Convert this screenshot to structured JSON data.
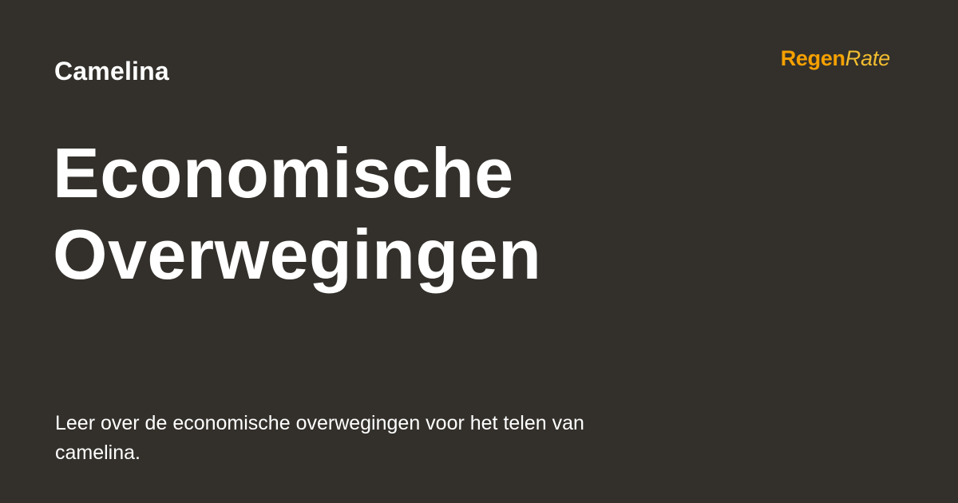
{
  "page": {
    "category": "Camelina",
    "title_lines": [
      "Economische",
      "Overwegingen"
    ],
    "description": "Leer over de economische overwegingen voor het telen van camelina."
  },
  "brand": {
    "name_bold": "Regen",
    "name_light": "Rate",
    "colors": {
      "bold": "#f5a000",
      "light": "#f2bd2f"
    }
  },
  "theme": {
    "background": "#33302b",
    "text": "#ffffff"
  }
}
